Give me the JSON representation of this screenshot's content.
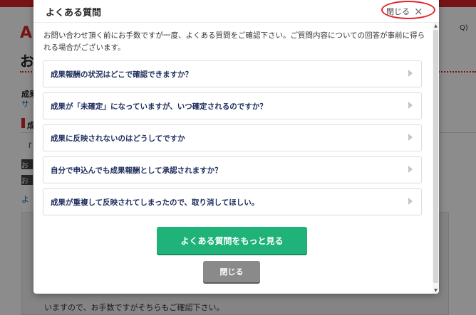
{
  "background": {
    "logo": "A",
    "faq_link": "Q)",
    "heading": "お",
    "text1": "成果",
    "text2": "サ",
    "section": "成",
    "quote": "「",
    "dark1": "お",
    "dark2": "お",
    "link3": "よ",
    "bottom_text": "いますので、お手数ですがそちらもご確認下さい。"
  },
  "modal": {
    "title": "よくある質問",
    "close_top_label": "閉じる",
    "close_icon": "×",
    "intro": "お問い合わせ頂く前にお手数ですが一度、よくある質問をご確認下さい。ご質問内容についての回答が事前に得られる場合がございます。",
    "faq_items": [
      {
        "question": "成果報酬の状況はどこで確認できますか？"
      },
      {
        "question": "成果が「未確定」になっていますが、いつ確定されるのですか？"
      },
      {
        "question": "成果に反映されないのはどうしてですか"
      },
      {
        "question": "自分で申込んでも成果報酬として承認されますか？"
      },
      {
        "question": "成果が重複して反映されてしまったので、取り消してほしい。"
      }
    ],
    "more_button_label": "よくある質問をもっと見る",
    "close_button_label": "閉じる"
  },
  "colors": {
    "accent_green": "#1fb37a",
    "close_grey": "#8a8a8a",
    "highlight_red": "#e0242b",
    "question_navy": "#1d2d5c"
  }
}
